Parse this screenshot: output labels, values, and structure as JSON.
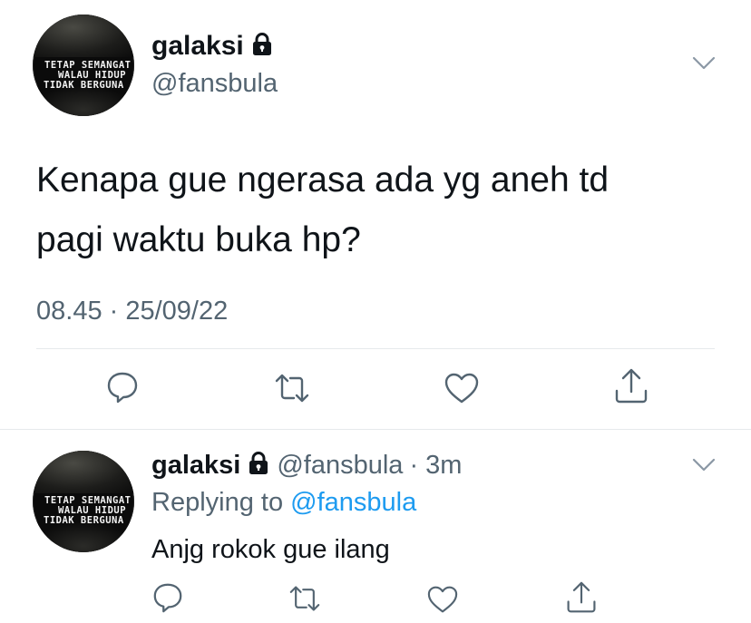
{
  "tweet": {
    "display_name": "galaksi",
    "handle": "@fansbula",
    "text_line1": "Kenapa gue ngerasa ada yg aneh td",
    "text_line2": "pagi waktu buka hp?",
    "timestamp": "08.45 · 25/09/22"
  },
  "avatar": {
    "line1": "TETAP SEMANGAT",
    "line2": "WALAU HIDUP",
    "line3": "TIDAK BERGUNA"
  },
  "reply": {
    "display_name": "galaksi",
    "handle": "@fansbula",
    "time": "· 3m",
    "replying_prefix": "Replying to",
    "replying_handle": "@fansbula",
    "text": "Anjg rokok gue ilang"
  },
  "actions": [
    "reply-icon",
    "retweet-icon",
    "like-icon",
    "share-icon"
  ],
  "colors": {
    "link": "#1d9bf0",
    "muted": "#536471",
    "text": "#0f1419"
  }
}
